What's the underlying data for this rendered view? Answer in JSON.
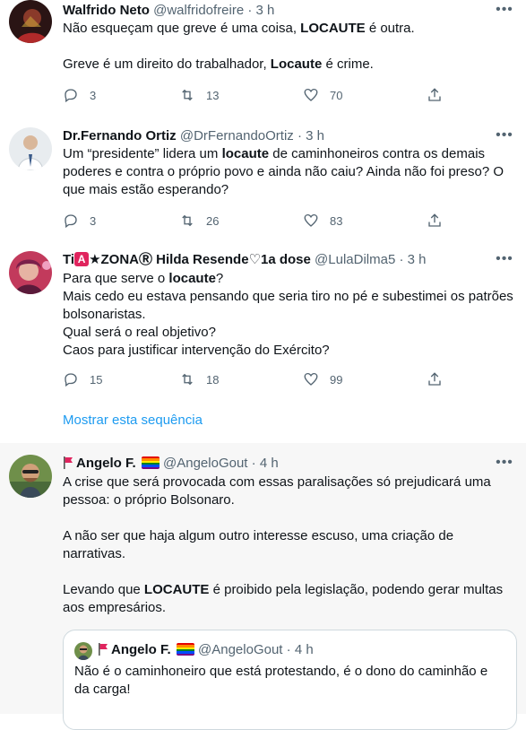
{
  "tweets": [
    {
      "name": "Walfrido Neto",
      "handle": "@walfridofreire",
      "time": "3 h",
      "lines": [
        [
          "Não esqueçam que greve é uma coisa, ",
          "LOCAUTE",
          " é outra."
        ],
        [
          "Greve é um direito do trabalhador, ",
          "Locaute",
          " é crime."
        ]
      ],
      "replies": "3",
      "retweets": "13",
      "likes": "70"
    },
    {
      "name": "Dr.Fernando Ortiz",
      "handle": "@DrFernandoOrtiz",
      "time": "3 h",
      "text_pre": "Um “presidente” lidera um ",
      "text_bold": "locaute",
      "text_post": " de caminhoneiros contra os demais poderes e contra o próprio povo e ainda não caiu? Ainda não foi preso? O que mais estão esperando?",
      "replies": "3",
      "retweets": "26",
      "likes": "83"
    },
    {
      "name_prefix": "Ti",
      "name_badge": "A",
      "name_rest": "★ZONAⓇ Hilda Resende♡1a dose",
      "handle": "@LulaDilma5",
      "time": "3 h",
      "line1_pre": "Para que serve o ",
      "line1_bold": "locaute",
      "line1_post": "?",
      "line2": "Mais cedo eu estava pensando que seria tiro no pé e subestimei os patrões bolsonaristas.",
      "line3": "Qual será o real objetivo?",
      "line4": "Caos para justificar intervenção do Exército?",
      "replies": "15",
      "retweets": "18",
      "likes": "99",
      "show_thread": "Mostrar esta sequência"
    },
    {
      "name": "Angelo F.",
      "handle": "@AngeloGout",
      "time": "4 h",
      "para1": "A crise que será provocada com essas paralisações só prejudicará uma pessoa: o próprio Bolsonaro.",
      "para2": "A não ser que haja algum outro interesse escuso, uma criação de narrativas.",
      "para3_pre": "Levando que ",
      "para3_bold": "LOCAUTE",
      "para3_post": " é proibido pela legislação, podendo gerar multas aos empresários.",
      "quote": {
        "name": "Angelo F.",
        "handle": "@AngeloGout",
        "time": "4 h",
        "text": "Não é o caminhoneiro que está protestando, é o dono do caminhão e da carga!"
      }
    }
  ],
  "separator": "·",
  "more_glyph": "•••",
  "colors": {
    "link": "#1d9bf0",
    "secondary_text": "#536471",
    "highlight_bg": "#f7f7f7",
    "border": "#eff3f4"
  },
  "icons": [
    "reply-icon",
    "retweet-icon",
    "like-icon",
    "share-icon",
    "more-icon",
    "flag-icon",
    "rainbow-flag-icon"
  ]
}
